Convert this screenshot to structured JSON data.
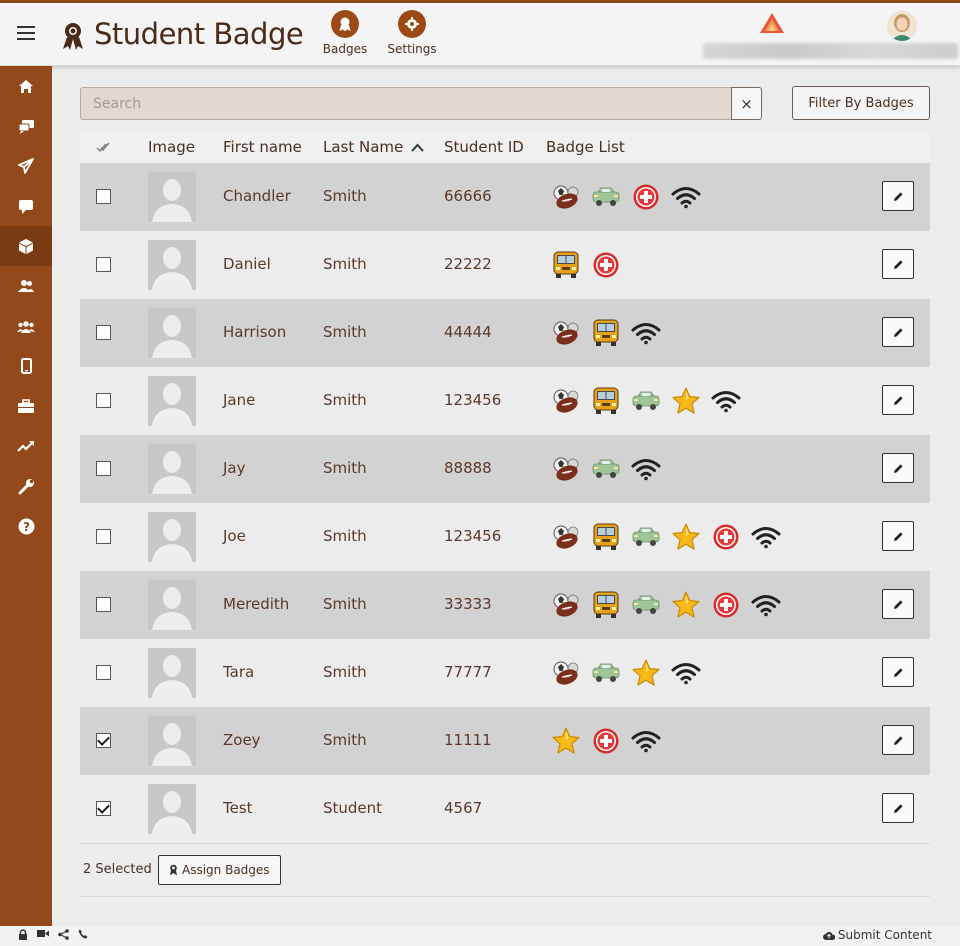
{
  "app": {
    "title": "Student Badge"
  },
  "nav": [
    {
      "label": "Badges",
      "icon": "award-icon"
    },
    {
      "label": "Settings",
      "icon": "gear-icon"
    }
  ],
  "sidebar": [
    {
      "icon": "home-icon"
    },
    {
      "icon": "chat-bubbles-icon"
    },
    {
      "icon": "paper-plane-icon"
    },
    {
      "icon": "message-icon"
    },
    {
      "icon": "cube-icon",
      "active": true
    },
    {
      "icon": "users-icon"
    },
    {
      "icon": "group-icon"
    },
    {
      "icon": "mobile-icon"
    },
    {
      "icon": "briefcase-icon"
    },
    {
      "icon": "trending-icon"
    },
    {
      "icon": "wrench-icon"
    },
    {
      "icon": "help-icon"
    }
  ],
  "search": {
    "placeholder": "Search",
    "value": "",
    "clear_label": "×"
  },
  "filter_label": "Filter By Badges",
  "table": {
    "headers": {
      "select": "",
      "image": "Image",
      "first": "First name",
      "last": "Last Name",
      "id": "Student ID",
      "badges": "Badge List"
    },
    "rows": [
      {
        "first": "Chandler",
        "last": "Smith",
        "id": "66666",
        "checked": false,
        "badges": [
          "football",
          "car",
          "firstaid",
          "wifi"
        ]
      },
      {
        "first": "Daniel",
        "last": "Smith",
        "id": "22222",
        "checked": false,
        "badges": [
          "bus",
          "firstaid"
        ]
      },
      {
        "first": "Harrison",
        "last": "Smith",
        "id": "44444",
        "checked": false,
        "badges": [
          "football",
          "bus",
          "wifi"
        ]
      },
      {
        "first": "Jane",
        "last": "Smith",
        "id": "123456",
        "checked": false,
        "badges": [
          "football",
          "bus",
          "car",
          "star",
          "wifi"
        ]
      },
      {
        "first": "Jay",
        "last": "Smith",
        "id": "88888",
        "checked": false,
        "badges": [
          "football",
          "car",
          "wifi"
        ]
      },
      {
        "first": "Joe",
        "last": "Smith",
        "id": "123456",
        "checked": false,
        "badges": [
          "football",
          "bus",
          "car",
          "star",
          "firstaid",
          "wifi"
        ]
      },
      {
        "first": "Meredith",
        "last": "Smith",
        "id": "33333",
        "checked": false,
        "badges": [
          "football",
          "bus",
          "car",
          "star",
          "firstaid",
          "wifi"
        ]
      },
      {
        "first": "Tara",
        "last": "Smith",
        "id": "77777",
        "checked": false,
        "badges": [
          "football",
          "car",
          "star",
          "wifi"
        ]
      },
      {
        "first": "Zoey",
        "last": "Smith",
        "id": "11111",
        "checked": true,
        "badges": [
          "star",
          "firstaid",
          "wifi"
        ]
      },
      {
        "first": "Test",
        "last": "Student",
        "id": "4567",
        "checked": true,
        "badges": []
      }
    ]
  },
  "footer": {
    "selected": "2 Selected",
    "assign_label": "Assign Badges"
  },
  "status": {
    "submit_label": "Submit Content"
  },
  "colors": {
    "brand": "#93491a",
    "text": "#5a3a2a",
    "row_shade": "#d2d2d2"
  }
}
